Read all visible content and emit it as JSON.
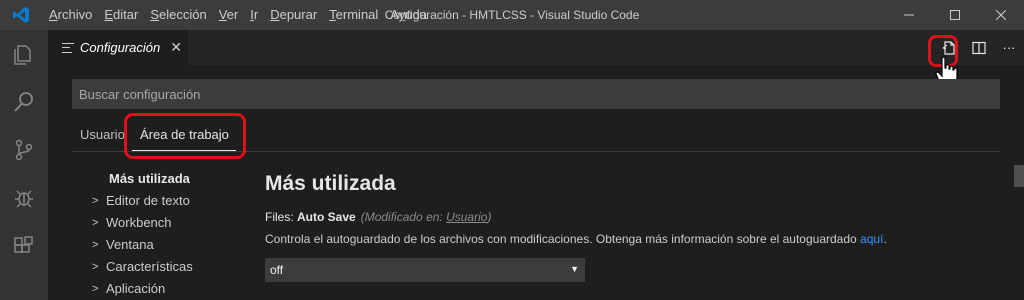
{
  "titlebar": {
    "window_title": "Configuración - HMTLCSS - Visual Studio Code",
    "menu": [
      {
        "pre": "",
        "u": "A",
        "post": "rchivo"
      },
      {
        "pre": "",
        "u": "E",
        "post": "ditar"
      },
      {
        "pre": "",
        "u": "S",
        "post": "elección"
      },
      {
        "pre": "",
        "u": "V",
        "post": "er"
      },
      {
        "pre": "",
        "u": "I",
        "post": "r"
      },
      {
        "pre": "",
        "u": "D",
        "post": "epurar"
      },
      {
        "pre": "",
        "u": "T",
        "post": "erminal"
      },
      {
        "pre": "A",
        "u": "y",
        "post": "uda"
      }
    ],
    "controls": {
      "minimize": "—",
      "maximize": "☐",
      "close": "✕"
    }
  },
  "activitybar": {
    "icons": [
      "explorer-icon",
      "search-icon",
      "source-control-icon",
      "debug-icon",
      "extensions-icon"
    ]
  },
  "tab": {
    "label": "Configuración",
    "close": "✕"
  },
  "editor_actions": {
    "more": "···"
  },
  "settings": {
    "search_placeholder": "Buscar configuración",
    "scope_user": "Usuario",
    "scope_workspace": "Área de trabajo",
    "toc": {
      "active": "Más utilizada",
      "items": [
        "Editor de texto",
        "Workbench",
        "Ventana",
        "Características",
        "Aplicación"
      ]
    },
    "section_title": "Más utilizada",
    "setting": {
      "category": "Files: ",
      "name": "Auto Save",
      "modified_prefix": "(Modificado en: ",
      "modified_link": "Usuario",
      "modified_suffix": ")",
      "description": "Controla el autoguardado de los archivos con modificaciones. Obtenga más información sobre el autoguardado ",
      "description_link": "aquí",
      "description_end": ".",
      "value": "off",
      "arrow": "▼"
    }
  },
  "colors": {
    "highlight": "#e0101a",
    "link": "#3794ff",
    "vscode_blue": "#0078d4"
  }
}
